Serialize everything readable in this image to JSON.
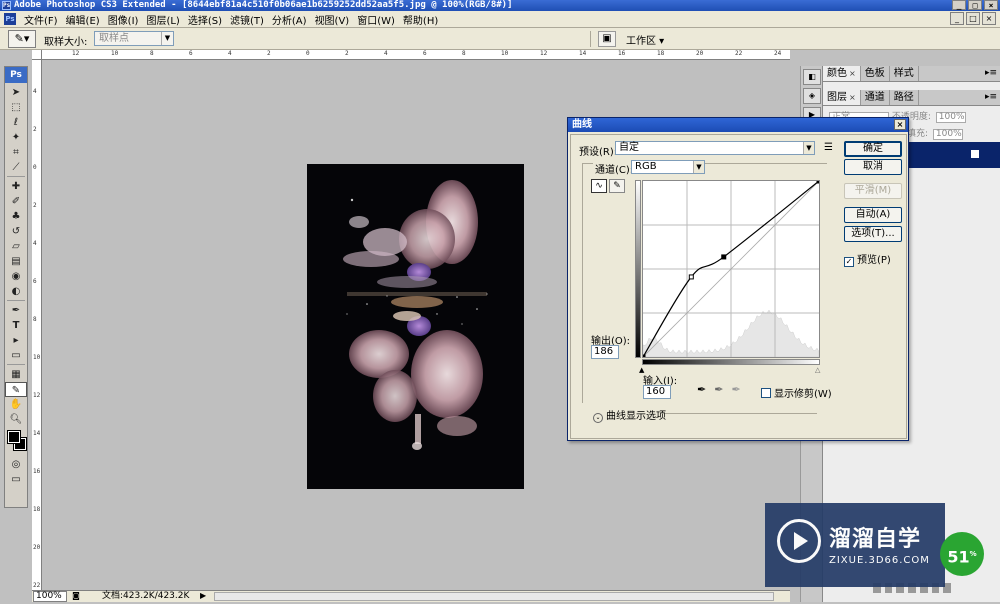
{
  "window": {
    "title": "Adobe Photoshop CS3 Extended - [8644ebf81a4c510f0b06ae1b6259252dd52aa5f5.jpg @ 100%(RGB/8#)]",
    "buttons": [
      "_",
      "□",
      "×"
    ]
  },
  "menu": [
    "文件(F)",
    "编辑(E)",
    "图像(I)",
    "图层(L)",
    "选择(S)",
    "滤镜(T)",
    "分析(A)",
    "视图(V)",
    "窗口(W)",
    "帮助(H)"
  ],
  "options": {
    "sample_label": "取样大小:",
    "sample_value": "取样点",
    "workspace": "工作区 ▾"
  },
  "ruler": {
    "h_ticks": [
      "12",
      "10",
      "8",
      "6",
      "4",
      "2",
      "0",
      "2",
      "4",
      "6",
      "8",
      "10",
      "12",
      "14",
      "16",
      "18",
      "20",
      "22",
      "24"
    ],
    "v_ticks": [
      "4",
      "2",
      "0",
      "2",
      "4",
      "6",
      "8",
      "10",
      "12",
      "14",
      "16",
      "18",
      "20",
      "22"
    ]
  },
  "status": {
    "zoom": "100%",
    "doc": "文档:423.2K/423.2K"
  },
  "panels": {
    "top_tabs": [
      "颜色",
      "色板",
      "样式"
    ],
    "layer_tabs": [
      "图层",
      "通道",
      "路径"
    ],
    "blend_mode": "正常",
    "opacity_label": "不透明度:",
    "opacity_value": "100%",
    "fill_label": "填充:",
    "fill_value": "100%"
  },
  "dialog": {
    "title": "曲线",
    "preset_label": "预设(R):",
    "preset_value": "自定",
    "channel_label": "通道(C):",
    "channel_value": "RGB",
    "output_label": "输出(O):",
    "output_value": "186",
    "input_label": "输入(I):",
    "input_value": "160",
    "show_clipping": "显示修剪(W)",
    "expander": "曲线显示选项",
    "buttons": {
      "ok": "确定",
      "cancel": "取消",
      "smooth": "平滑(M)",
      "auto": "自动(A)",
      "options": "选项(T)..."
    },
    "preview_label": "预览(P)",
    "preview_checked": true,
    "curve_points": [
      [
        0,
        0
      ],
      [
        70,
        116
      ],
      [
        117,
        145
      ],
      [
        255,
        255
      ]
    ]
  },
  "watermark": {
    "cn": "溜溜自学",
    "en": "ZIXUE.3D66.COM"
  },
  "badge": {
    "value": "51",
    "unit": "%"
  },
  "colors": {
    "title_bar": "#1f4fb4",
    "selection": "#0a246a",
    "badge": "#2aa532"
  }
}
